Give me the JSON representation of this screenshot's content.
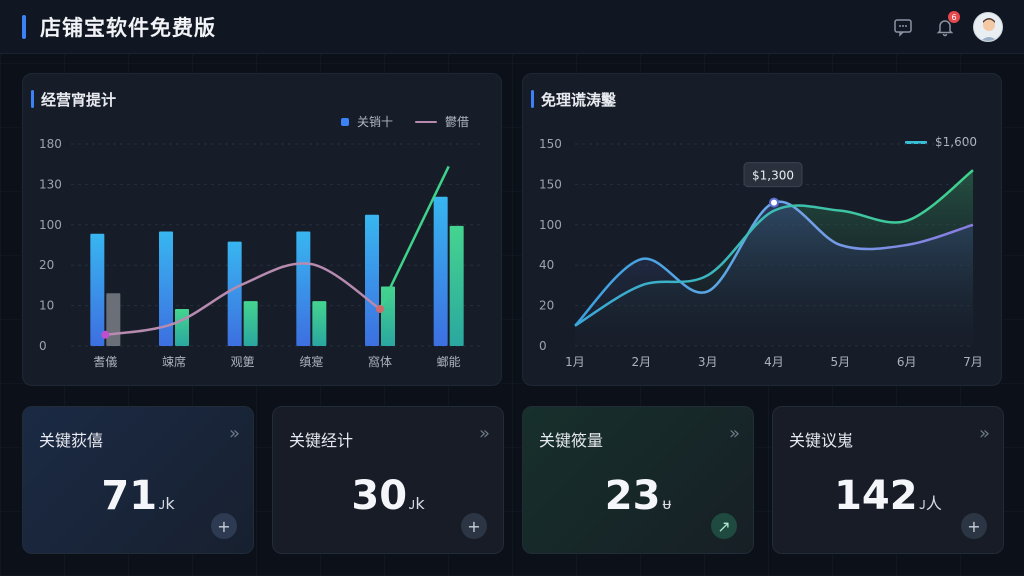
{
  "header": {
    "title": "店铺宝软件免费版",
    "notification_count": "6",
    "icons": {
      "message": "chat-icon",
      "notification": "bell-icon",
      "avatar": "user-avatar"
    }
  },
  "colors": {
    "accent": "#3b82f6",
    "bar_blue": "#3b9ee8",
    "bar_green": "#34c27e",
    "line_pink": "#b78bb0",
    "line_green": "#3fd28c",
    "line_purple": "#8b7be0",
    "line_cyan": "#39c0d9"
  },
  "left_chart": {
    "title": "经营宵提计",
    "legend_bar": "关销十",
    "legend_line": "鬱借"
  },
  "right_chart": {
    "title": "免理谎涛鑿",
    "legend": "$1,600",
    "tooltip": "$1,300"
  },
  "chart_data": [
    {
      "type": "bar",
      "title": "经营宵提计",
      "categories": [
        "耆儀",
        "竦席",
        "观筻",
        "缜寔",
        "窩体",
        "螂能"
      ],
      "y_tick_labels": [
        "0",
        "10",
        "20",
        "100",
        "130",
        "180"
      ],
      "series": [
        {
          "name": "关销十",
          "kind": "bar",
          "values": [
            100,
            102,
            93,
            102,
            117,
            133
          ]
        },
        {
          "kind": "bar",
          "values": [
            47,
            33,
            40,
            40,
            53,
            107
          ]
        },
        {
          "name": "鬱借",
          "kind": "line",
          "values": [
            10,
            20,
            55,
            73,
            33,
            160
          ]
        }
      ],
      "ylim": [
        0,
        180
      ],
      "grid": true,
      "legend_position": "top-right"
    },
    {
      "type": "line",
      "title": "免理谎涛鑿",
      "categories": [
        "1月",
        "2月",
        "3月",
        "4月",
        "5月",
        "6月",
        "7月"
      ],
      "y_tick_labels": [
        "0",
        "20",
        "40",
        "100",
        "150",
        "150"
      ],
      "series": [
        {
          "name": "$1,600",
          "values": [
            10,
            30,
            35,
            67,
            67,
            62,
            87
          ]
        },
        {
          "values": [
            10,
            43,
            27,
            71,
            50,
            50,
            60
          ]
        }
      ],
      "tooltip_label": "$1,300",
      "ylim": [
        0,
        100
      ],
      "grid": true,
      "legend_position": "top-right"
    }
  ],
  "kpis": [
    {
      "title": "关键荻僖",
      "value": "71",
      "unit": "ᴊk",
      "button": "+"
    },
    {
      "title": "关键经计",
      "value": "30",
      "unit": "ᴊk",
      "button": "+"
    },
    {
      "title": "关键筱量",
      "value": "23",
      "unit": "ᵾ",
      "button": "↗"
    },
    {
      "title": "关键议嵬",
      "value": "142",
      "unit": "ᴊ人",
      "button": "+"
    }
  ],
  "kpi_arrow": "»"
}
